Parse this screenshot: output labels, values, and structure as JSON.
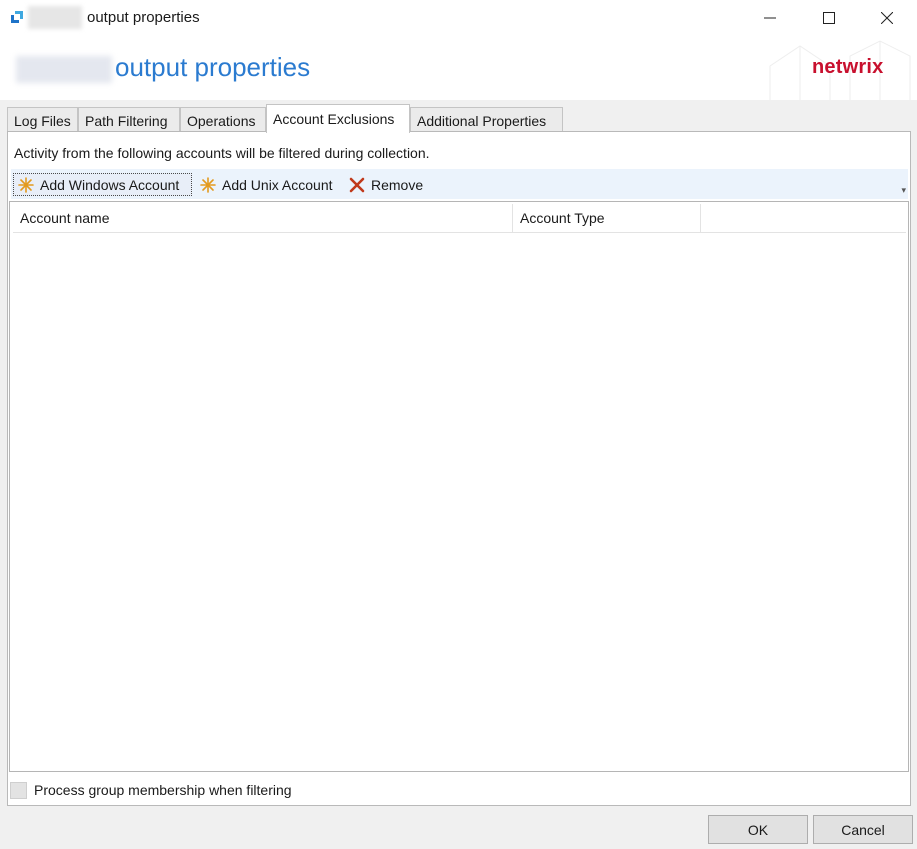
{
  "window": {
    "title": "output properties",
    "header_title": "output properties",
    "brand": "netwrix"
  },
  "tabs": [
    {
      "label": "Log Files",
      "active": false
    },
    {
      "label": "Path Filtering",
      "active": false
    },
    {
      "label": "Operations",
      "active": false
    },
    {
      "label": "Account Exclusions",
      "active": true
    },
    {
      "label": "Additional Properties",
      "active": false
    }
  ],
  "panel": {
    "description": "Activity from the following accounts will be filtered during collection."
  },
  "toolbar": {
    "add_windows_label": "Add Windows Account",
    "add_unix_label": "Add Unix Account",
    "remove_label": "Remove",
    "overflow_glyph": "▾"
  },
  "table": {
    "columns": [
      "Account name",
      "Account Type"
    ],
    "rows": []
  },
  "options": {
    "process_group_label": "Process group membership when filtering",
    "process_group_checked": false
  },
  "footer": {
    "ok_label": "OK",
    "cancel_label": "Cancel"
  },
  "colors": {
    "accent": "#2b7bd0",
    "brand": "#c8102e",
    "toolbar_bg": "#ebf3fc"
  }
}
